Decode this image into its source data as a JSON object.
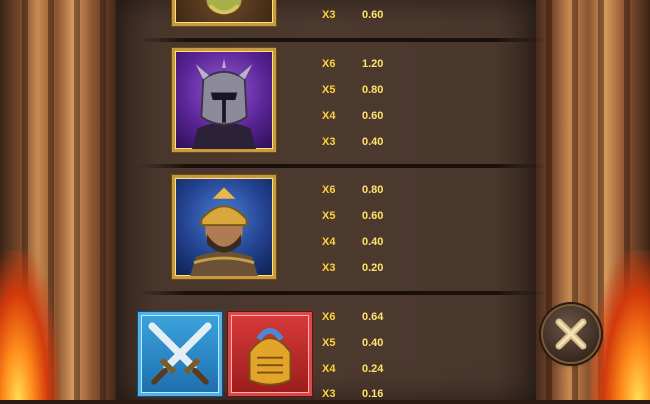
{
  "paytable": {
    "groups": [
      {
        "symbol": "purple-gladiator-helmet",
        "payouts": [
          {
            "mult": "X3",
            "value": "0.60"
          }
        ]
      },
      {
        "symbol": "purple-armored-warrior",
        "payouts": [
          {
            "mult": "X6",
            "value": "1.20"
          },
          {
            "mult": "X5",
            "value": "0.80"
          },
          {
            "mult": "X4",
            "value": "0.60"
          },
          {
            "mult": "X3",
            "value": "0.40"
          }
        ]
      },
      {
        "symbol": "blue-roman-soldier",
        "payouts": [
          {
            "mult": "X6",
            "value": "0.80"
          },
          {
            "mult": "X5",
            "value": "0.60"
          },
          {
            "mult": "X4",
            "value": "0.40"
          },
          {
            "mult": "X3",
            "value": "0.20"
          }
        ]
      },
      {
        "symbol": "crossed-swords-and-golden-helmet",
        "payouts": [
          {
            "mult": "X6",
            "value": "0.64"
          },
          {
            "mult": "X5",
            "value": "0.40"
          },
          {
            "mult": "X4",
            "value": "0.24"
          },
          {
            "mult": "X3",
            "value": "0.16"
          }
        ]
      }
    ]
  },
  "icons": {
    "close": "close-x-icon"
  },
  "colors": {
    "payout_text": "#ffd23a",
    "frame_gold": "#c99a3c",
    "panel": "#4d3a2f"
  }
}
